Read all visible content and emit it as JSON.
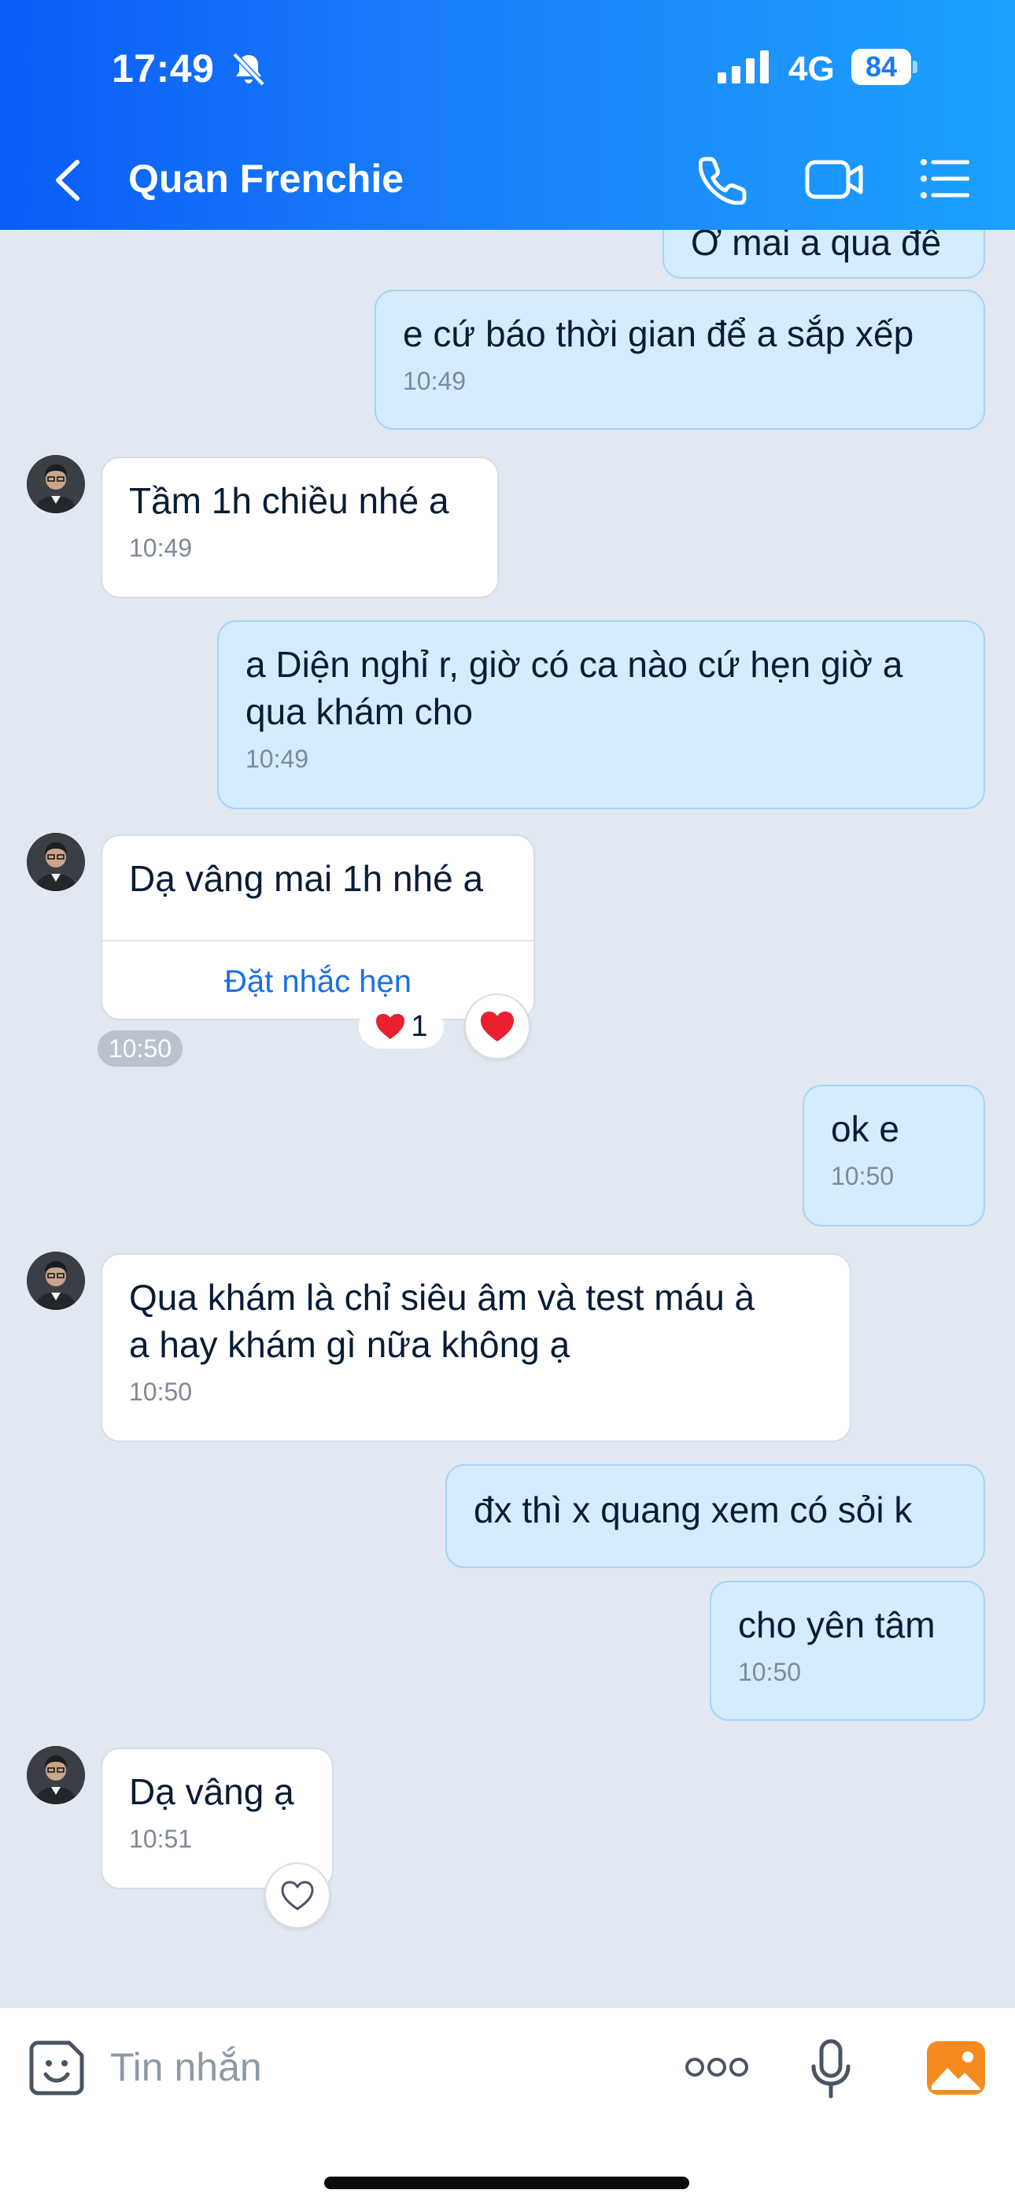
{
  "status_bar": {
    "time": "17:49",
    "network": "4G",
    "battery": "84"
  },
  "header": {
    "contact_name": "Quan Frenchie"
  },
  "messages": [
    {
      "id": "m0",
      "side": "sent",
      "text": "Ơ mai a qua đê",
      "time": ""
    },
    {
      "id": "m1",
      "side": "sent",
      "text": "e cứ báo thời gian để a sắp xếp",
      "time": "10:49"
    },
    {
      "id": "m2",
      "side": "received",
      "text": "Tầm 1h chiều nhé a",
      "time": "10:49"
    },
    {
      "id": "m3",
      "side": "sent",
      "text": "a Diện nghỉ r, giờ có ca nào cứ hẹn giờ a\nqua khám cho",
      "time": "10:49"
    },
    {
      "id": "m4",
      "side": "received",
      "text": "Dạ vâng mai 1h nhé a",
      "time": "10:50",
      "action": "Đặt nhắc hẹn",
      "reactions": {
        "emoji": "heart",
        "count": "1"
      }
    },
    {
      "id": "m5",
      "side": "sent",
      "text": "ok e",
      "time": "10:50"
    },
    {
      "id": "m6",
      "side": "received",
      "text": "Qua khám là chỉ siêu âm và test máu à\na hay khám gì nữa không ạ",
      "time": "10:50"
    },
    {
      "id": "m7",
      "side": "sent",
      "text": "đx thì x quang xem có sỏi k",
      "time": ""
    },
    {
      "id": "m8",
      "side": "sent",
      "text": "cho yên tâm",
      "time": "10:50"
    },
    {
      "id": "m9",
      "side": "received",
      "text": "Dạ vâng ạ",
      "time": "10:51"
    }
  ],
  "input": {
    "placeholder": "Tin nhắn"
  },
  "colors": {
    "header_gradient_start": "#0a5df7",
    "header_gradient_end": "#1aa1ff",
    "chat_background": "#e2e8f1",
    "sent_bubble": "#d4ecfd",
    "received_bubble": "#ffffff",
    "link_blue": "#1a70e8",
    "heart_red": "#e8202f",
    "image_icon_orange": "#f58b1f"
  },
  "icons": {
    "header": [
      "back-arrow-icon",
      "phone-icon",
      "video-camera-icon",
      "list-menu-icon"
    ],
    "status": [
      "bell-muted-icon",
      "signal-icon",
      "battery-icon"
    ],
    "input_bar": [
      "sticker-icon",
      "more-icon",
      "microphone-icon",
      "image-icon"
    ]
  }
}
